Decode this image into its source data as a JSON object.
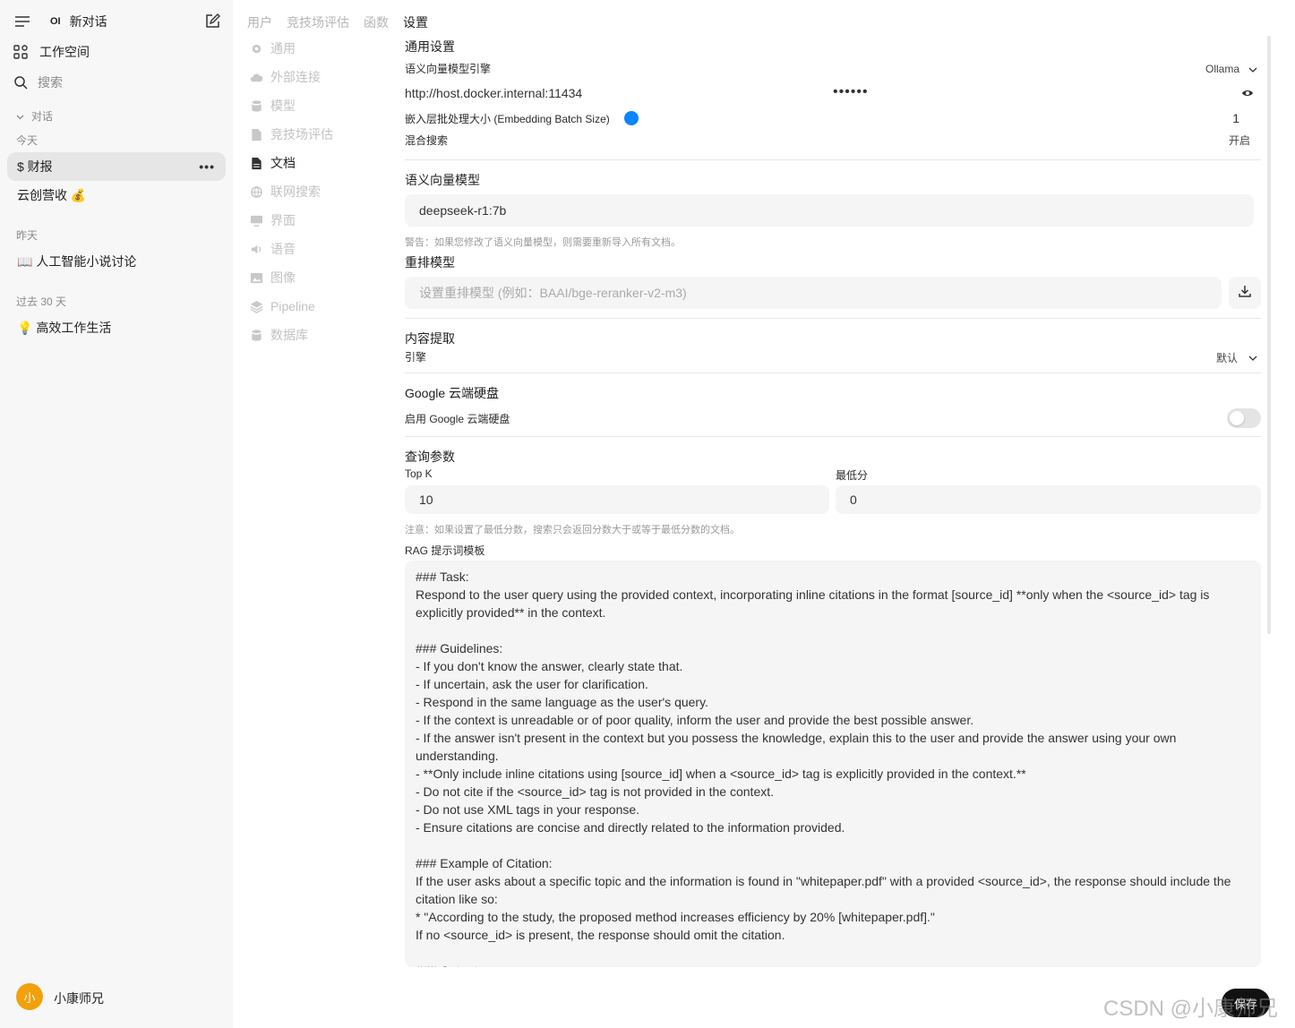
{
  "sidebar": {
    "new_chat": "新对话",
    "logo": "OI",
    "workspace": "工作空间",
    "search": "搜索",
    "chats_header": "对话",
    "today": "今天",
    "chat_caibao": "$ 财报",
    "chat_yunchuang": "云创营收 💰",
    "yesterday": "昨天",
    "chat_ai_novel": "📖 人工智能小说讨论",
    "past30": "过去 30 天",
    "chat_efficiency": "💡 高效工作生活",
    "more": "•••",
    "user_avatar": "小",
    "user_name": "小康师兄"
  },
  "top_tabs": [
    "用户",
    "竞技场评估",
    "函数",
    "设置"
  ],
  "settings_nav": [
    {
      "label": "通用",
      "icon": "gear-icon"
    },
    {
      "label": "外部连接",
      "icon": "cloud-icon"
    },
    {
      "label": "模型",
      "icon": "database-icon"
    },
    {
      "label": "竞技场评估",
      "icon": "document-icon"
    },
    {
      "label": "文档",
      "icon": "document-icon"
    },
    {
      "label": "联网搜索",
      "icon": "globe-icon"
    },
    {
      "label": "界面",
      "icon": "monitor-icon"
    },
    {
      "label": "语音",
      "icon": "speaker-icon"
    },
    {
      "label": "图像",
      "icon": "image-icon"
    },
    {
      "label": "Pipeline",
      "icon": "layers-icon"
    },
    {
      "label": "数据库",
      "icon": "database-icon"
    }
  ],
  "general": {
    "title": "通用设置",
    "engine_label": "语义向量模型引擎",
    "engine_value": "Ollama",
    "url": "http://host.docker.internal:11434",
    "api_key_mask": "••••••",
    "batch_label": "嵌入层批处理大小 (Embedding Batch Size)",
    "batch_value": "1",
    "hybrid_label": "混合搜索",
    "hybrid_value": "开启"
  },
  "embedding": {
    "title": "语义向量模型",
    "model": "deepseek-r1:7b",
    "warning": "警告：如果您修改了语义向量模型，则需要重新导入所有文档。"
  },
  "reranking": {
    "title": "重排模型",
    "placeholder": "设置重排模型 (例如：BAAI/bge-reranker-v2-m3)"
  },
  "extraction": {
    "title": "内容提取",
    "engine_label": "引擎",
    "engine_value": "默认"
  },
  "gdrive": {
    "title": "Google 云端硬盘",
    "enable_label": "启用 Google 云端硬盘",
    "enabled": false
  },
  "query": {
    "title": "查询参数",
    "topk_label": "Top K",
    "topk_value": "10",
    "minscore_label": "最低分",
    "minscore_value": "0",
    "note": "注意：如果设置了最低分数，搜索只会返回分数大于或等于最低分数的文档。",
    "rag_label": "RAG 提示词模板",
    "rag_template": "### Task:\nRespond to the user query using the provided context, incorporating inline citations in the format [source_id] **only when the <source_id> tag is explicitly provided** in the context.\n\n### Guidelines:\n- If you don't know the answer, clearly state that.\n- If uncertain, ask the user for clarification.\n- Respond in the same language as the user's query.\n- If the context is unreadable or of poor quality, inform the user and provide the best possible answer.\n- If the answer isn't present in the context but you possess the knowledge, explain this to the user and provide the answer using your own understanding.\n- **Only include inline citations using [source_id] when a <source_id> tag is explicitly provided in the context.**\n- Do not cite if the <source_id> tag is not provided in the context.\n- Do not use XML tags in your response.\n- Ensure citations are concise and directly related to the information provided.\n\n### Example of Citation:\nIf the user asks about a specific topic and the information is found in \"whitepaper.pdf\" with a provided <source_id>, the response should include the citation like so:\n* \"According to the study, the proposed method increases efficiency by 20% [whitepaper.pdf].\"\nIf no <source_id> is present, the response should omit the citation.\n\n### Output:"
  },
  "save_label": "保存",
  "watermark": "CSDN @小康师兄",
  "colors": {
    "accent": "#0a84ff",
    "avatar": "#f2a10c"
  }
}
